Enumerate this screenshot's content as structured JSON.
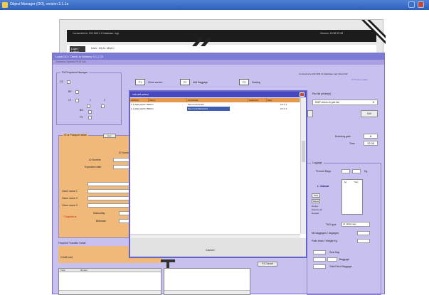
{
  "app": {
    "title": "Object Manager (OO), version 2.1.1a"
  },
  "login": {
    "connected_text": "Connected to: 192.168.1.1   Database: mgr",
    "version_text": "Version: 15.08.23.08",
    "logout_label": "Login / Logout",
    "user_label": "User: 10 AL MALC"
  },
  "main": {
    "title": "Local OCI: Check-In Window 3.1.2.23",
    "menu": "Sessions  Options  FIDS  Info",
    "connected_text": "Connected to 192.168.1.1 Database mgr Client 042",
    "ready_text": "# Check-in ready",
    "peripheral_legend": "Fill Peripheral Manager",
    "peripheral_labels": [
      "CS",
      "BP",
      "CT",
      "1",
      "2",
      "BG",
      "FS"
    ],
    "fkeys": [
      {
        "key": "F1",
        "label": "Close screen"
      },
      {
        "key": "F2",
        "label": "Add Baggage"
      },
      {
        "key": "F3",
        "label": "Seating"
      }
    ],
    "printer_label": "Pax list printer(s)",
    "printer_value": "DMP check-in pax list",
    "exit_label": "Exit",
    "passenger_legend": "ID or Passport detail",
    "passenger_tab": "Doc.",
    "id_label": "ID Number",
    "id_number_label": "ID Number",
    "expiration_label": "Expiration date",
    "name_label": "Name",
    "given_names": [
      "Given name 1",
      "Given name 2",
      "Given name 3"
    ],
    "nationality_label": "Nationality",
    "birthdate_label": "Birthdate",
    "tag_label": "*Tagstatus",
    "frequent_label": "Frequent Traveller Detail",
    "credit_label": "Credit card",
    "boarding_label": "Boarding gate",
    "boarding_value": "A",
    "time_label": "Time",
    "time_value": "12:00",
    "luggage_legend": "Luggage",
    "present_bags_label": "Present Bags",
    "kg_label": "Kg",
    "luggage_header": "L. manual",
    "luggage_col1": "kg",
    "luggage_col2": "Seq",
    "luggage_buttons": [
      "Print",
      "Delete"
    ],
    "luggage_notes": [
      "Drop-o",
      "Delivery all",
      "Receipt"
    ],
    "tag_type_label": "TAG type",
    "tag_type_value": "14 bidlaunage",
    "nb_baggage_label": "Nb baggages / bag/ages",
    "pads_label": "Pads tears / Weight Kg",
    "left_table_headers": [
      "Time",
      "ID-user"
    ],
    "cancel_button": "F4 Cancel",
    "bottom_labels": [
      "Seat flag",
      "Baggage",
      "Total Extra Baggage"
    ]
  },
  "popup": {
    "title": "xml-unit-select",
    "columns": [
      "OPRNO",
      "PRCA",
      "PAXNAME",
      "CHECKID",
      "SEQ"
    ],
    "rows": [
      [
        "1 1 (H)E (H)CR 7890XJ",
        "",
        "Mouri-GrimSmiFt",
        "",
        "0 0 0 1"
      ],
      [
        "1 1 (H)E (H)CR 7890XJ",
        "",
        "Mouri-GrimBankHFH",
        "",
        "0 0 0 1"
      ]
    ],
    "selected_row": 1,
    "cancel_label": "Cancel"
  },
  "colors": {
    "title_blue": "#2d5fb8",
    "window_lavender": "#c8c0ee",
    "header_orange": "#e7994f",
    "selection_blue": "#3d5fb3",
    "panel_orange": "#f0b97a"
  }
}
